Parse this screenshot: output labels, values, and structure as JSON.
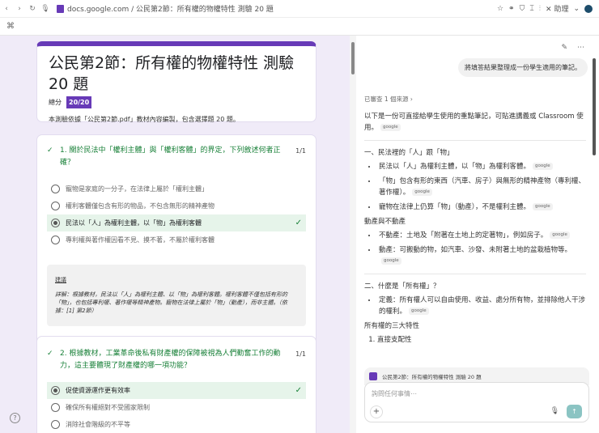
{
  "browser": {
    "url": "docs.google.com / 公民第2節：所有權的物權特性 測驗 20 題",
    "assist_label": "助理"
  },
  "form": {
    "title": "公民第2節：所有權的物權特性 測驗 20 題",
    "score_label": "總分",
    "score": "20/20",
    "description": "本測驗依據「公民第2節.pdf」教材內容編製，包含選擇題 20 題。",
    "questions": [
      {
        "title": "1. 關於民法中「權利主體」與「權利客體」的界定，下列敘述何者正確？",
        "points": "1/1",
        "options": [
          "寵物是家庭的一分子，在法律上屬於「權利主體」",
          "權利客體僅包含有形的物品，不包含無形的精神產物",
          "民法以「人」為權利主體，以「物」為權利客體",
          "專利權與著作權因看不見、摸不著，不屬於權利客體"
        ],
        "selected": 2,
        "feedback_label": "建議",
        "feedback": "詳解：根據教材，民法以「人」為權利主體、以「物」為權利客體。權利客體不僅包括有形的「物」，也包括專利權、著作權等精神產物。寵物在法律上屬於「物」（動產），而非主體。（依據：[1] 第2節）"
      },
      {
        "title": "2. 根據教材，工業革命後私有財產權的保障被視為人們勤奮工作的動力，這主要體現了財產權的哪一項功能？",
        "points": "1/1",
        "options": [
          "促使資源運作更有效率",
          "確保所有權絕對不受國家限制",
          "消除社會階級的不平等"
        ],
        "selected": 0
      }
    ]
  },
  "assistant": {
    "user_message": "將填答結果整理成一份學生適用的筆記。",
    "sources": "已審查 1 個來源 ›",
    "intro": "以下是一份可直接給學生使用的重點筆記，可貼進講義或 Classroom 使用。",
    "tag": "google",
    "sec1": "一、民法裡的「人」跟「物」",
    "sec1_items": [
      "民法以「人」為權利主體，以「物」為權利客體。",
      "「物」包含有形的東西（汽車、房子）與無形的精神產物（專利權、著作權）。",
      "寵物在法律上仍算「物」（動產），不是權利主體。"
    ],
    "sub1": "動產與不動產",
    "sub1_items": [
      "不動產：土地及「附著在土地上的定著物」，例如房子。",
      "動產：可搬動的物，如汽車、沙發、未附著土地的盆栽植物等。"
    ],
    "sec2": "二、什麼是「所有權」？",
    "sec2_items": [
      "定義：所有權人可以自由使用、收益、處分所有物，並排除他人干涉的權利。"
    ],
    "sub2": "所有權的三大特性",
    "sub2_items": [
      "直接支配性"
    ],
    "context_doc": "公民第2節：所有權的物權特性 測驗 20 題",
    "placeholder": "詢問任何事情⋯"
  }
}
